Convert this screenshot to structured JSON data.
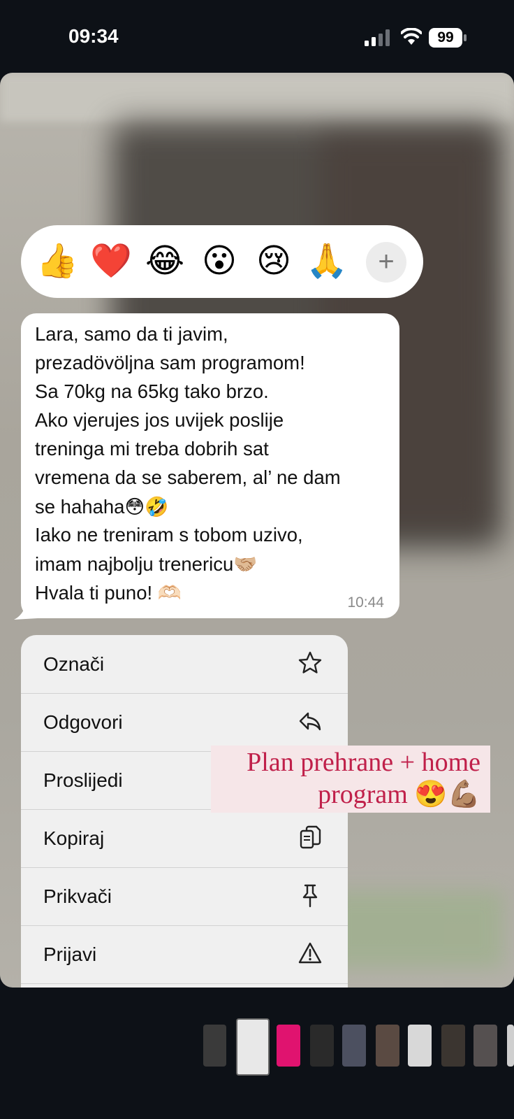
{
  "status_bar": {
    "time": "09:34",
    "battery": "99"
  },
  "reactions": {
    "emojis": [
      "👍",
      "❤️",
      "😂",
      "😮",
      "😢",
      "🙏"
    ],
    "more": "+"
  },
  "message": {
    "lines": [
      "Lara, samo da ti javim,",
      "prezadövöljna sam programom!",
      "Sa 70kg na 65kg tako brzo.",
      "Ako vjerujes jos uvijek poslije",
      "treninga mi treba dobrih sat",
      "vremena da se saberem, al’ ne dam",
      "se hahaha😳🤣",
      "Iako ne treniram s tobom uzivo,",
      "imam najbolju trenericu🤝🏼",
      "Hvala ti puno! 🫶🏻"
    ],
    "time": "10:44"
  },
  "menu": {
    "items": [
      {
        "label": "Označi",
        "icon": "star-icon"
      },
      {
        "label": "Odgovori",
        "icon": "reply-icon"
      },
      {
        "label": "Proslijedi",
        "icon": "forward-icon"
      },
      {
        "label": "Kopiraj",
        "icon": "copy-icon"
      },
      {
        "label": "Prikvači",
        "icon": "pin-icon"
      },
      {
        "label": "Prijavi",
        "icon": "warning-icon"
      }
    ]
  },
  "caption": {
    "line1": "Plan prehrane + home",
    "line2": "program 😍💪🏽",
    "color": "#c0204a"
  },
  "thumbnails": {
    "count": 10,
    "colors": [
      "#3a3a3a",
      "#e8e8e8",
      "#e0136f",
      "#2a2a2a",
      "#4c5060",
      "#5a4a42",
      "#d8d8d8",
      "#3b3530",
      "#555050",
      "#cfcfcf"
    ]
  }
}
